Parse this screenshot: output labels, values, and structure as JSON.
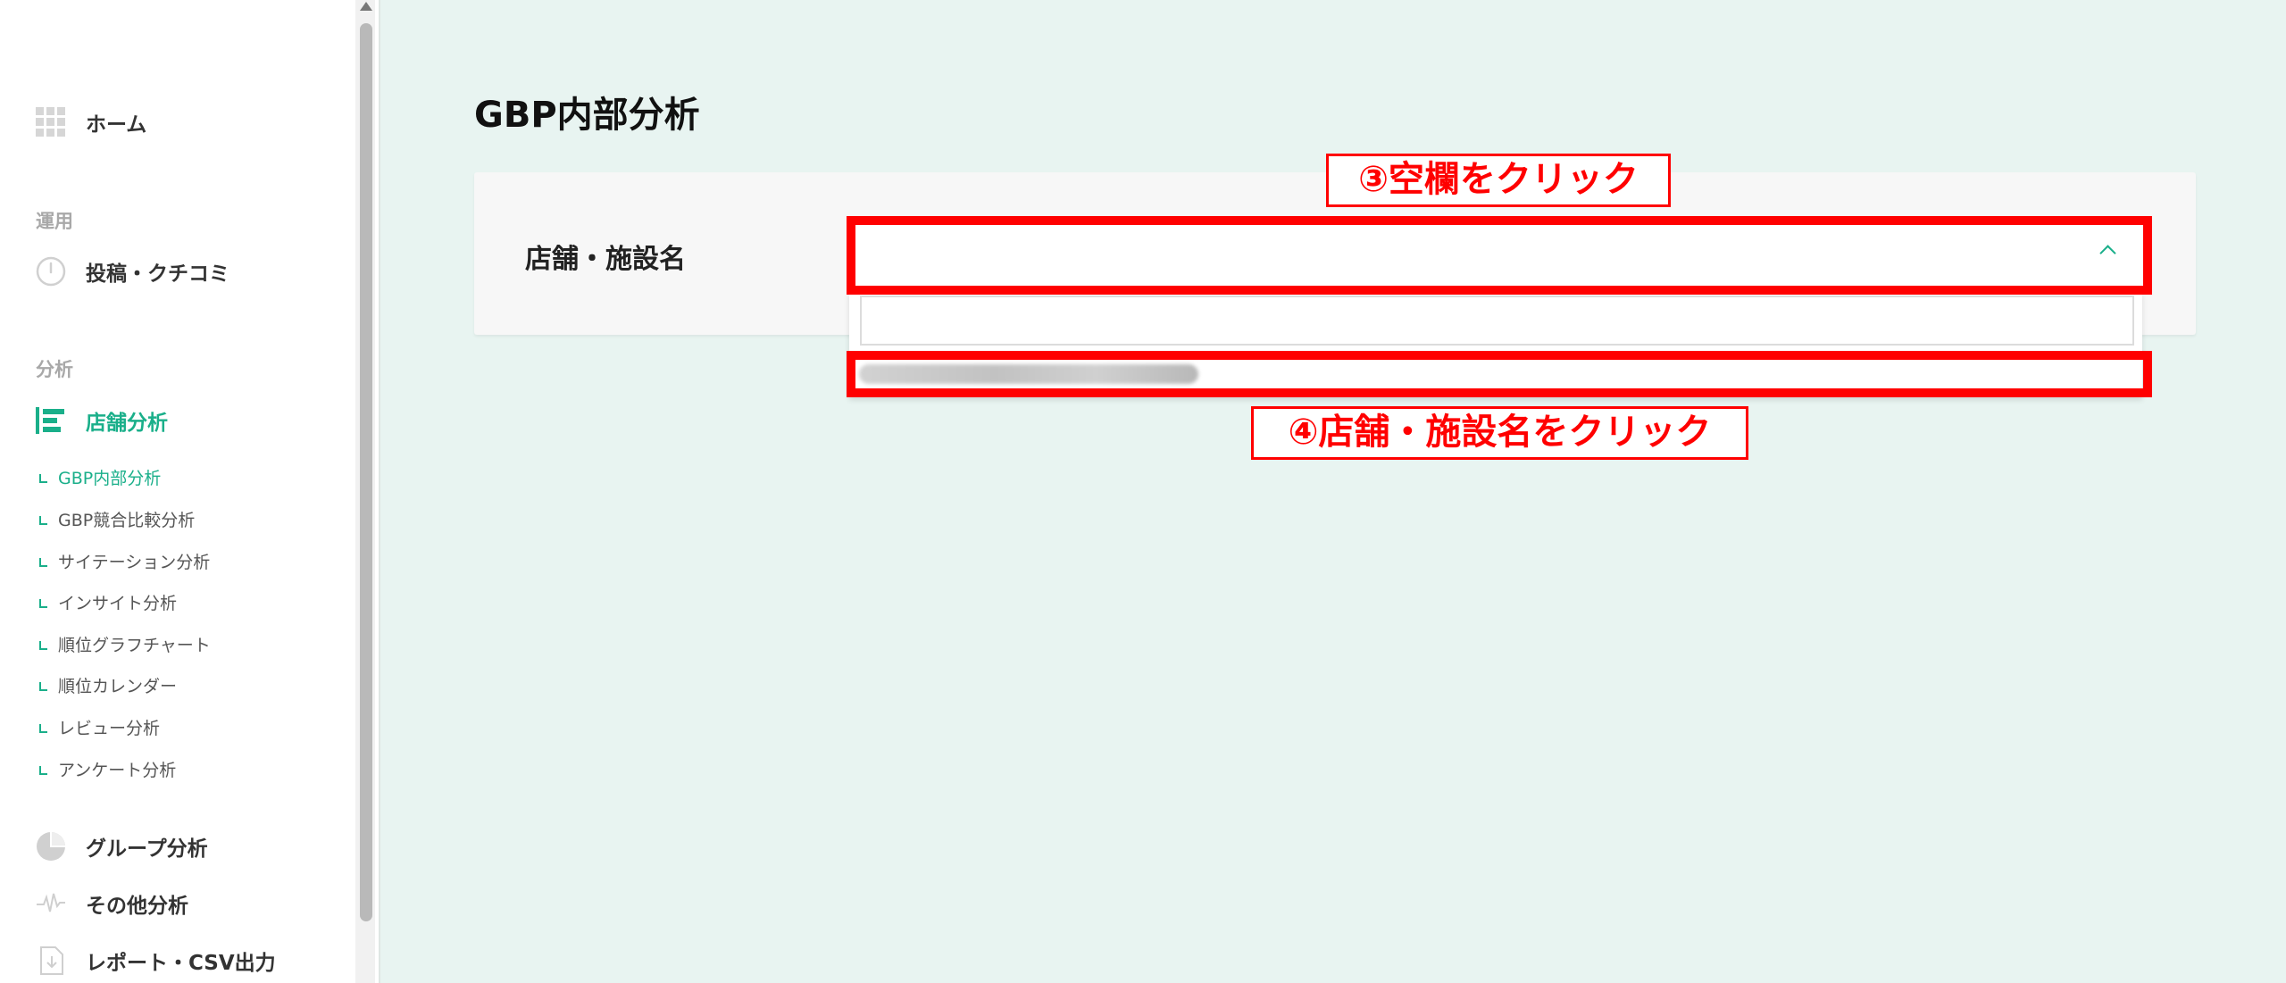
{
  "sidebar": {
    "home": {
      "label": "ホーム",
      "icon": "grid-icon"
    },
    "sections": {
      "operations": "運用",
      "analysis": "分析"
    },
    "posts": {
      "label": "投稿・クチコミ",
      "icon": "clock-icon"
    },
    "store_analysis": {
      "label": "店舗分析",
      "icon": "bar-chart-icon",
      "children": [
        "GBP内部分析",
        "GBP競合比較分析",
        "サイテーション分析",
        "インサイト分析",
        "順位グラフチャート",
        "順位カレンダー",
        "レビュー分析",
        "アンケート分析"
      ]
    },
    "group": {
      "label": "グループ分析",
      "icon": "pie-chart-icon"
    },
    "other": {
      "label": "その他分析",
      "icon": "pulse-icon"
    },
    "report": {
      "label": "レポート・CSV出力",
      "icon": "download-file-icon"
    }
  },
  "main": {
    "title": "GBP内部分析",
    "field_label": "店舗・施設名",
    "select_value": "",
    "search_value": ""
  },
  "annotations": {
    "step3": "③空欄をクリック",
    "step4": "④店舗・施設名をクリック"
  },
  "colors": {
    "accent": "#1aaf8a",
    "annotation": "#ff0000",
    "background": "#e8f4f1"
  }
}
